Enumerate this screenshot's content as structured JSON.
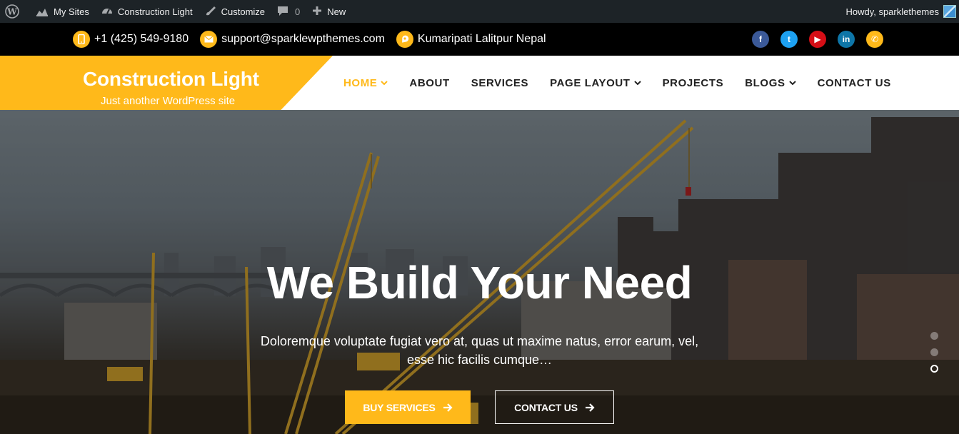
{
  "adminbar": {
    "my_sites": "My Sites",
    "site_name": "Construction Light",
    "customize": "Customize",
    "comments_count": "0",
    "new_label": "New",
    "howdy": "Howdy, sparklethemes"
  },
  "topbar": {
    "phone": "+1 (425) 549-9180",
    "email": "support@sparklewpthemes.com",
    "address": "Kumaripati Lalitpur Nepal",
    "socials": [
      {
        "name": "facebook",
        "glyph": "f",
        "color": "#3b5998"
      },
      {
        "name": "twitter",
        "glyph": "t",
        "color": "#1da1f2"
      },
      {
        "name": "youtube",
        "glyph": "▶",
        "color": "#d50e16"
      },
      {
        "name": "linkedin",
        "glyph": "in",
        "color": "#0e76a8"
      },
      {
        "name": "phone-call",
        "glyph": "✆",
        "color": "#ffb91a"
      }
    ]
  },
  "brand": {
    "title": "Construction Light",
    "tagline": "Just another WordPress site",
    "accent": "#ffb91a"
  },
  "nav": {
    "items": [
      {
        "label": "HOME",
        "dropdown": true,
        "active": true
      },
      {
        "label": "ABOUT",
        "dropdown": false,
        "active": false
      },
      {
        "label": "SERVICES",
        "dropdown": false,
        "active": false
      },
      {
        "label": "PAGE LAYOUT",
        "dropdown": true,
        "active": false
      },
      {
        "label": "PROJECTS",
        "dropdown": false,
        "active": false
      },
      {
        "label": "BLOGS",
        "dropdown": true,
        "active": false
      },
      {
        "label": "CONTACT US",
        "dropdown": false,
        "active": false
      }
    ]
  },
  "hero": {
    "heading": "We Build Your Need",
    "subtext_line1": "Doloremque voluptate fugiat vero at, quas ut maxime natus, error earum, vel,",
    "subtext_line2": "esse hic facilis cumque…",
    "buy_button": "BUY SERVICES",
    "contact_button": "CONTACT US",
    "slides_count": 3,
    "active_slide": 3
  }
}
